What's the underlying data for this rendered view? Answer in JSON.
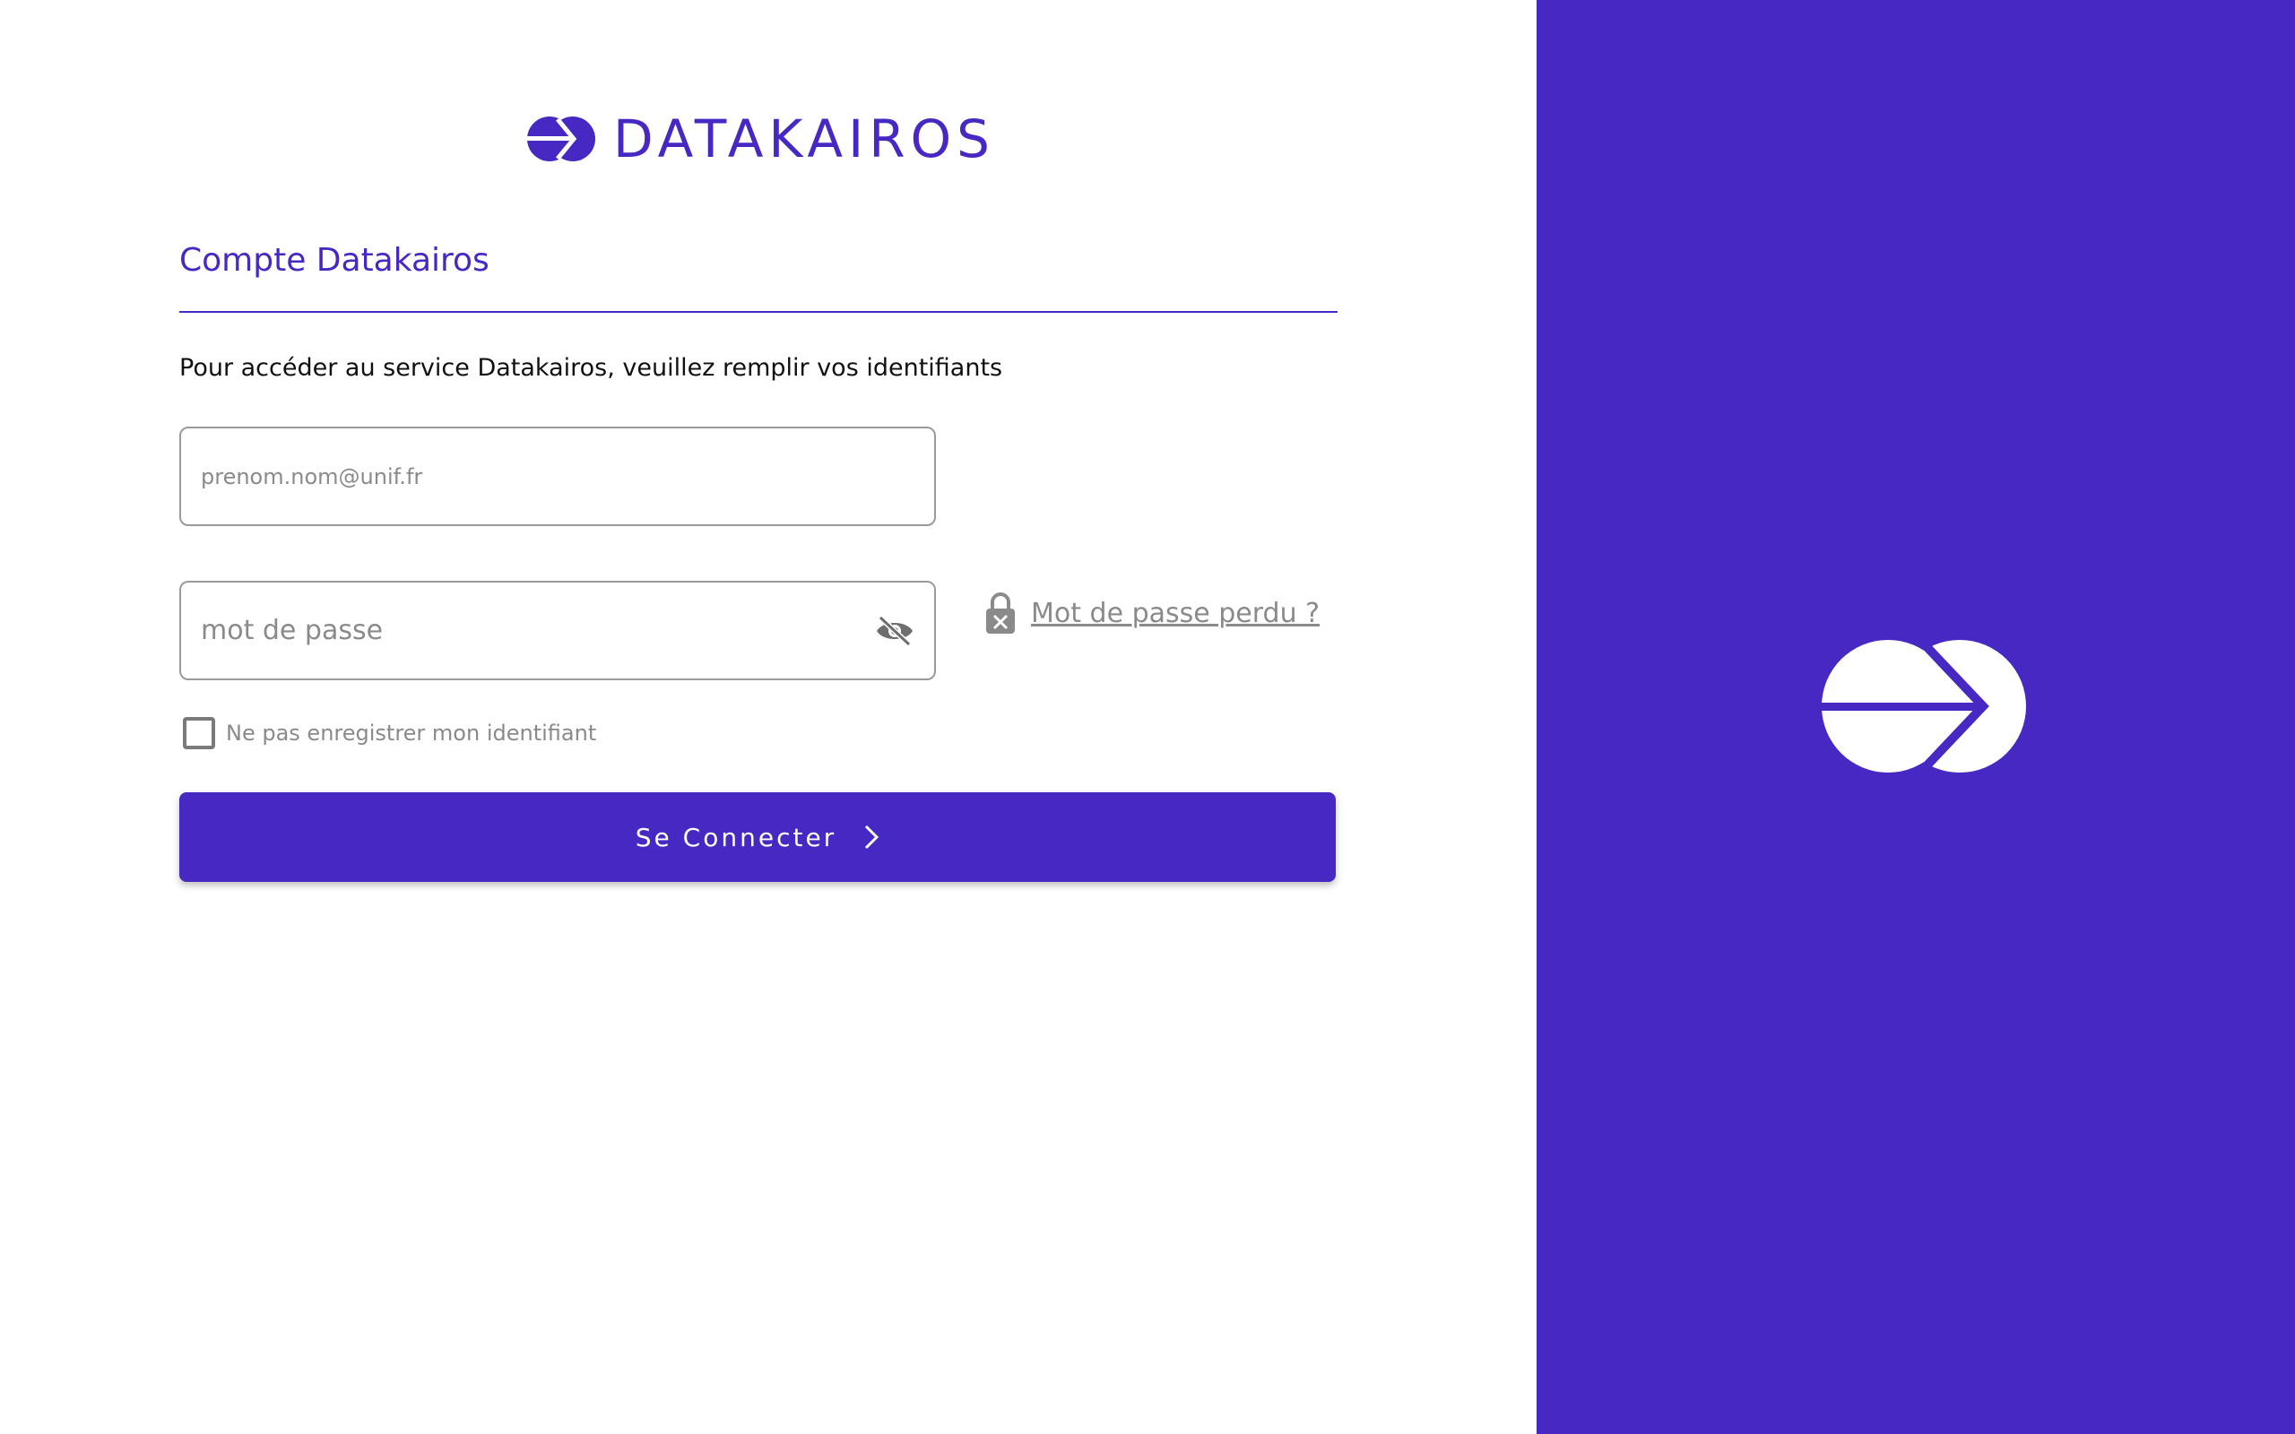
{
  "brand": {
    "name": "DATAKAIROS",
    "primary_color": "#4828c2",
    "logo_icon": "datakairos-logo-icon"
  },
  "form": {
    "section_title": "Compte Datakairos",
    "intro": "Pour accéder au service Datakairos, veuillez remplir vos identifiants",
    "email": {
      "placeholder": "prenom.nom@unif.fr",
      "value": ""
    },
    "password": {
      "placeholder": "mot de passe",
      "value": "",
      "toggle_icon": "eye-off-icon"
    },
    "forgot": {
      "label": " Mot de passe perdu ?",
      "icon": "lock-x-icon"
    },
    "remember": {
      "label": "Ne pas enregistrer mon identifiant",
      "checked": false
    },
    "submit": {
      "label": "Se Connecter",
      "icon": "chevron-right-icon"
    }
  },
  "side_panel": {
    "icon": "datakairos-large-logo-icon",
    "background": "#4828c2"
  }
}
